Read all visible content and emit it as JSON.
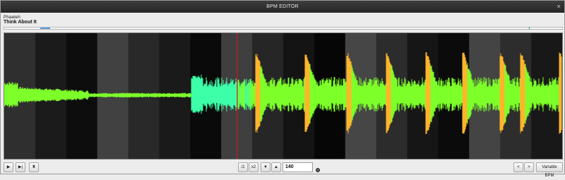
{
  "window": {
    "title": "BPM EDITOR",
    "close_glyph": "×"
  },
  "track": {
    "artist": "Phaeleh",
    "title": "Think About It"
  },
  "overview": {
    "selection_color": "#5a9be0",
    "marker_color": "#2aa860"
  },
  "waveform": {
    "colors": {
      "low": "#7dff2a",
      "mid": "#3dffa8",
      "transient": "#ffb52a",
      "cursor": "#d01818"
    },
    "beat_band_colors": [
      "#2f2f2f",
      "#1b1b1b",
      "#0d0d0d",
      "#414141",
      "#292929",
      "#1a1a1a",
      "#0a0a0a",
      "#3f3f3f",
      "#262626",
      "#141414",
      "#060606",
      "#464646",
      "#2c2c2c",
      "#161616",
      "#0b0b0b",
      "#444444",
      "#2d2d2d",
      "#181818"
    ]
  },
  "toolbar": {
    "play_icon": "▶",
    "skip_end_icon": "▶|",
    "metronome_icon": "♜",
    "half_label": "/2",
    "double_label": "x2",
    "down_icon": "▼",
    "up_icon": "▲",
    "bpm_value": "140",
    "reset_icon": "×",
    "prev_label": "<",
    "next_label": ">",
    "variable_bpm_label": "Variable BPM"
  }
}
